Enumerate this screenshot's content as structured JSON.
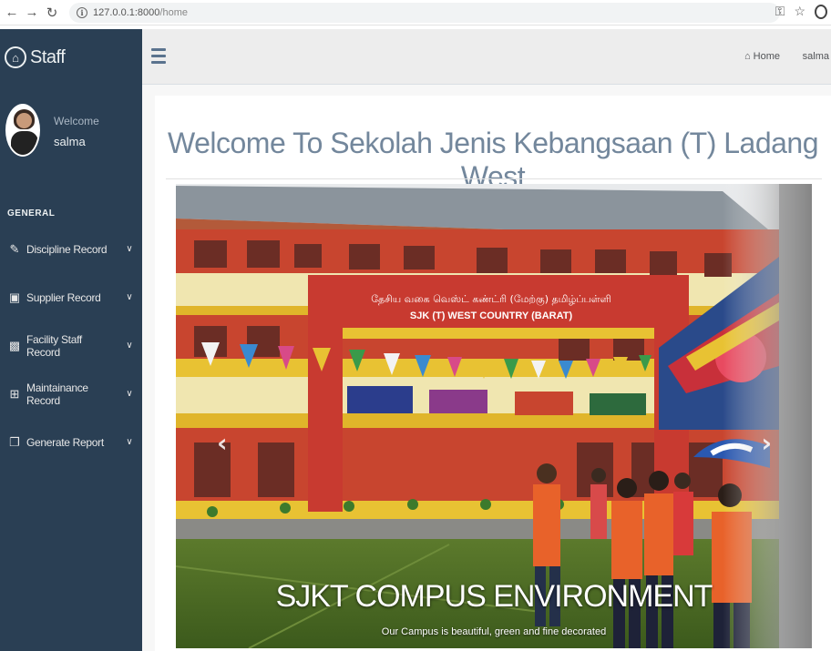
{
  "browser": {
    "url_host": "127.0.0.1:8000",
    "url_path": "/home"
  },
  "sidebar": {
    "brand": "Staff",
    "welcome_label": "Welcome",
    "username": "salma",
    "section_title": "GENERAL",
    "menu": [
      {
        "label": "Discipline Record",
        "icon": "edit-icon"
      },
      {
        "label": "Supplier Record",
        "icon": "desktop-icon"
      },
      {
        "label": "Facility Staff Record",
        "icon": "bar-chart-icon"
      },
      {
        "label": "Maintainance Record",
        "icon": "table-icon"
      },
      {
        "label": "Generate Report",
        "icon": "clone-icon"
      }
    ]
  },
  "topnav": {
    "home_label": "Home",
    "user_label": "salma"
  },
  "main": {
    "title": "Welcome To Sekolah Jenis Kebangsaan (T) Ladang West",
    "carousel": {
      "caption_title": "SJKT COMPUS ENVIRONMENT",
      "caption_text": "Our Campus is beautiful, green and fine decorated",
      "sign_tamil": "தேசிய வகை வெஸ்ட் கண்ட்ரி (மேற்கு) தமிழ்ப்பள்ளி",
      "sign_text": "SJK (T) WEST COUNTRY (BARAT)"
    }
  },
  "colors": {
    "sidebar_bg": "#2a3f54",
    "title_color": "#73879c",
    "topnav_bg": "#ededed"
  }
}
